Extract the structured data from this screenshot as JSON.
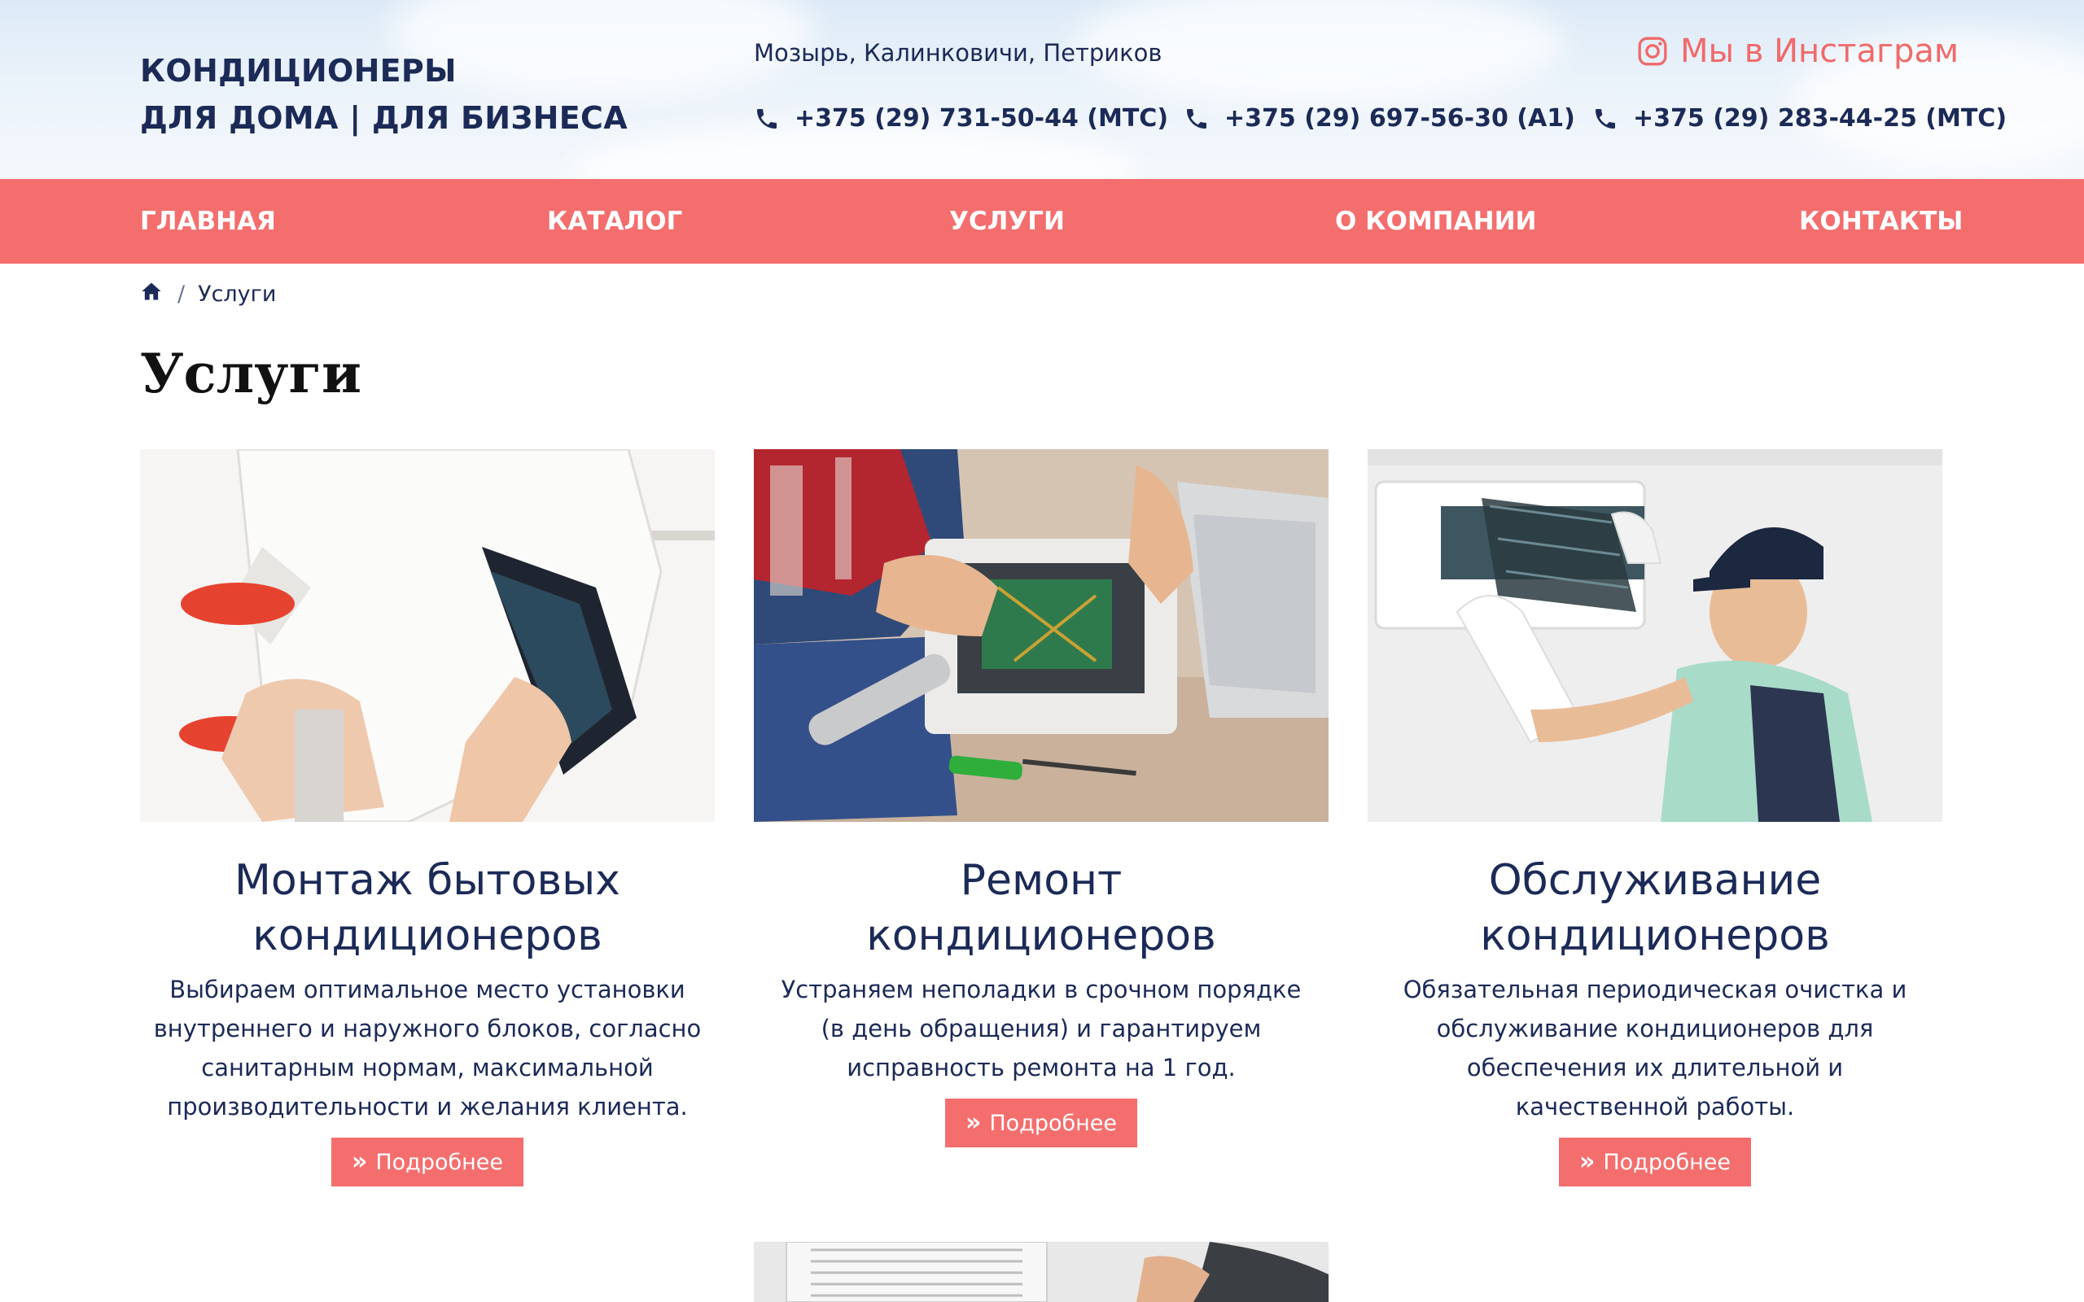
{
  "header": {
    "brand_line1": "КОНДИЦИОНЕРЫ",
    "brand_line2": "ДЛЯ ДОМА | ДЛЯ БИЗНЕСА",
    "cities": "Мозырь, Калинковичи, Петриков",
    "phones": [
      "+375 (29) 731-50-44 (МТС)",
      "+375 (29) 697-56-30 (А1)",
      "+375 (29) 283-44-25 (МТС)"
    ],
    "instagram_label": "Мы в Инстаграм",
    "phone_icon": "phone-icon",
    "instagram_icon": "instagram-icon"
  },
  "nav": {
    "items": [
      "ГЛАВНАЯ",
      "КАТАЛОГ",
      "УСЛУГИ",
      "О КОМПАНИИ",
      "КОНТАКТЫ"
    ]
  },
  "breadcrumb": {
    "home_icon": "home-icon",
    "separator": "/",
    "current": "Услуги"
  },
  "page_title": "Услуги",
  "services": [
    {
      "title": "Монтаж бытовых кондиционеров",
      "text": "Выбираем оптимальное место установки внутреннего и наружного блоков, согласно санитарным нормам, максимальной производительности и желания клиента.",
      "button": "Подробнее"
    },
    {
      "title": "Ремонт кондиционеров",
      "text": "Устраняем неполадки в срочном порядке (в день обращения) и гарантируем исправность ремонта на 1 год.",
      "button": "Подробнее"
    },
    {
      "title": "Обслуживание кондиционеров",
      "text": "Обязательная периодическая очистка и обслуживание кондиционеров для обеспечения их длительной и качественной работы.",
      "button": "Подробнее"
    }
  ],
  "colors": {
    "accent": "#f46e6e",
    "text": "#1b2a57",
    "header_bg": "#dceaf7"
  }
}
